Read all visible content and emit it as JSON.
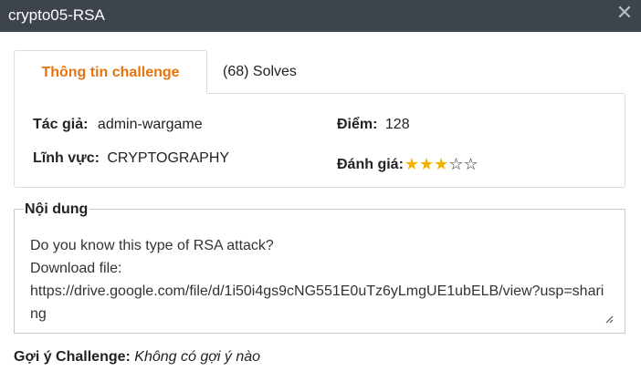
{
  "window": {
    "title": "crypto05-RSA",
    "close_symbol": "✕"
  },
  "tabs": [
    {
      "label": "Thông tin challenge",
      "active": true
    },
    {
      "label": "(68) Solves",
      "active": false
    }
  ],
  "info": {
    "author_label": "Tác giả:",
    "author_value": "admin-wargame",
    "points_label": "Điểm:",
    "points_value": "128",
    "category_label": "Lĩnh vực:",
    "category_value": "CRYPTOGRAPHY",
    "rating_label": "Đánh giá:",
    "rating_value": 3,
    "rating_max": 5
  },
  "content": {
    "legend": "Nội dung",
    "text": "Do you know this type of RSA attack?\nDownload file:\nhttps://drive.google.com/file/d/1i50i4gs9cNG551E0uTz6yLmgUE1ubELB/view?usp=sharing"
  },
  "hint": {
    "label": "Gợi ý Challenge:",
    "value": "Không có gợi ý nào"
  },
  "colors": {
    "titlebar": "#3e444c",
    "accent": "#e8720c",
    "star_filled": "#f0b300"
  },
  "icons": {
    "close": "close-icon",
    "star_filled": "star-filled-icon",
    "star_empty": "star-empty-icon",
    "resize": "resize-handle-icon"
  }
}
